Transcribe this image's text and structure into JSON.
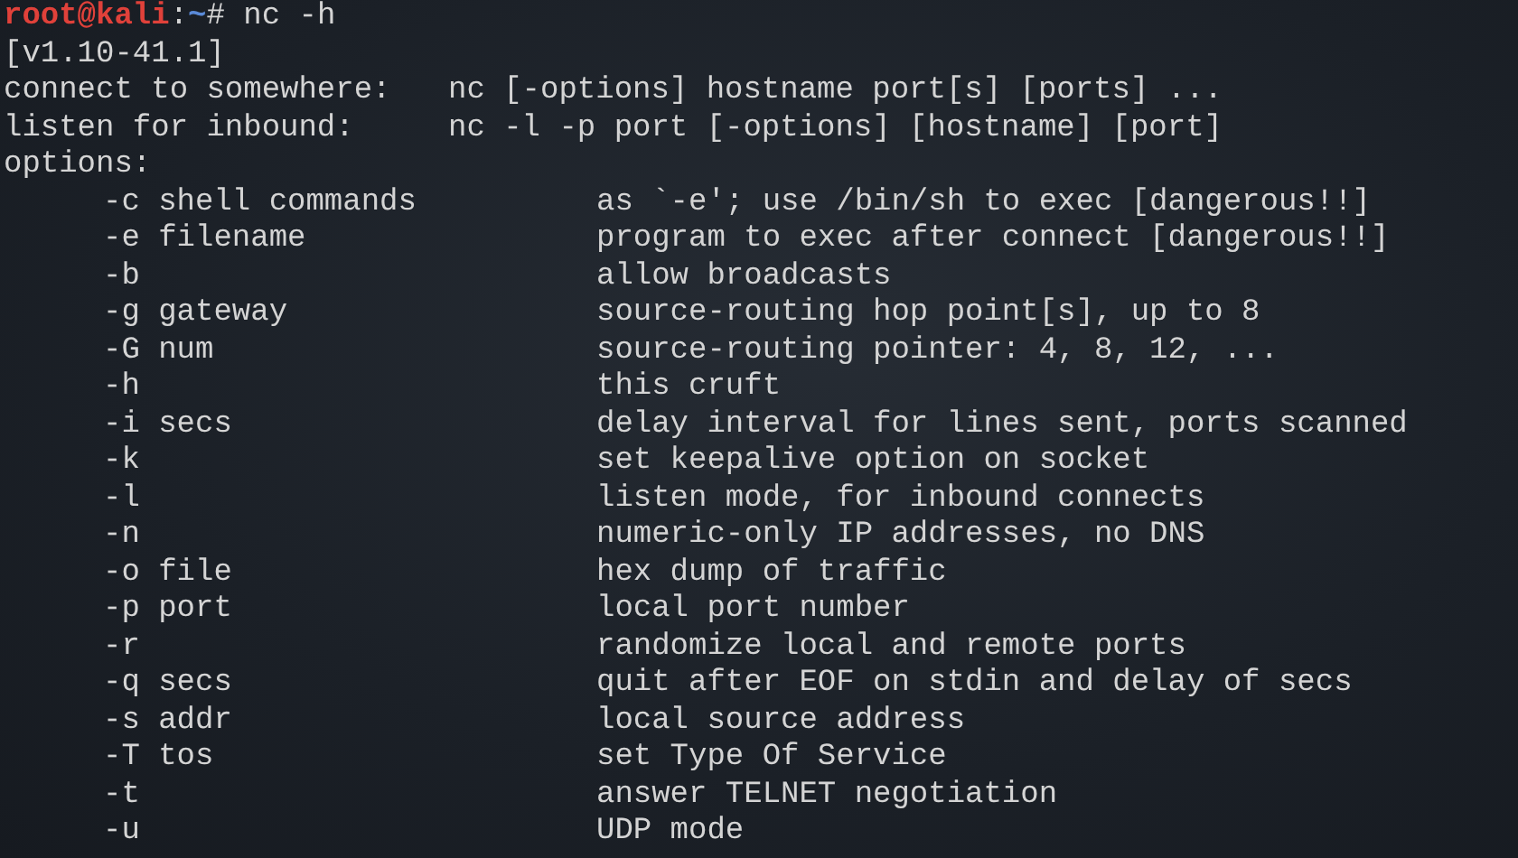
{
  "prompt": {
    "user_host": "root@kali",
    "separator": ":",
    "path": "~",
    "symbol": "#",
    "command": "nc -h"
  },
  "version": "[v1.10-41.1]",
  "usage": [
    {
      "label": "connect to somewhere:",
      "syntax": "nc [-options] hostname port[s] [ports] ..."
    },
    {
      "label": "listen for inbound:",
      "syntax": "nc -l -p port [-options] [hostname] [port]"
    }
  ],
  "options_heading": "options:",
  "options": [
    {
      "flag": "-c shell commands",
      "description": "as `-e'; use /bin/sh to exec [dangerous!!]"
    },
    {
      "flag": "-e filename",
      "description": "program to exec after connect [dangerous!!]"
    },
    {
      "flag": "-b",
      "description": "allow broadcasts"
    },
    {
      "flag": "-g gateway",
      "description": "source-routing hop point[s], up to 8"
    },
    {
      "flag": "-G num",
      "description": "source-routing pointer: 4, 8, 12, ..."
    },
    {
      "flag": "-h",
      "description": "this cruft"
    },
    {
      "flag": "-i secs",
      "description": "delay interval for lines sent, ports scanned"
    },
    {
      "flag": "-k",
      "description": "set keepalive option on socket"
    },
    {
      "flag": "-l",
      "description": "listen mode, for inbound connects"
    },
    {
      "flag": "-n",
      "description": "numeric-only IP addresses, no DNS"
    },
    {
      "flag": "-o file",
      "description": "hex dump of traffic"
    },
    {
      "flag": "-p port",
      "description": "local port number"
    },
    {
      "flag": "-r",
      "description": "randomize local and remote ports"
    },
    {
      "flag": "-q secs",
      "description": "quit after EOF on stdin and delay of secs"
    },
    {
      "flag": "-s addr",
      "description": "local source address"
    },
    {
      "flag": "-T tos",
      "description": "set Type Of Service"
    },
    {
      "flag": "-t",
      "description": "answer TELNET negotiation"
    },
    {
      "flag": "-u",
      "description": "UDP mode"
    }
  ]
}
